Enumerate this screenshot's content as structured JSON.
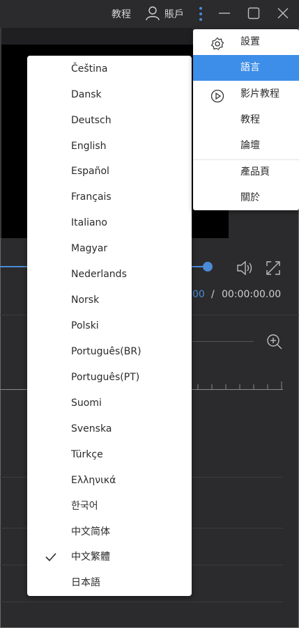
{
  "titlebar": {
    "tutorial_label": "教程",
    "account_label": "賬戶"
  },
  "player": {
    "current_time": "00",
    "time_separator": "/",
    "total_time": "00:00:00.00"
  },
  "language_menu": {
    "items": [
      {
        "label": "Čeština"
      },
      {
        "label": "Dansk"
      },
      {
        "label": "Deutsch"
      },
      {
        "label": "English"
      },
      {
        "label": "Español"
      },
      {
        "label": "Français"
      },
      {
        "label": "Italiano"
      },
      {
        "label": "Magyar"
      },
      {
        "label": "Nederlands"
      },
      {
        "label": "Norsk"
      },
      {
        "label": "Polski"
      },
      {
        "label": "Português(BR)"
      },
      {
        "label": "Português(PT)"
      },
      {
        "label": "Suomi"
      },
      {
        "label": "Svenska"
      },
      {
        "label": "Türkçe"
      },
      {
        "label": "Ελληνικά"
      },
      {
        "label": "한국어"
      },
      {
        "label": "中文简体"
      },
      {
        "label": "中文繁體",
        "selected": true
      },
      {
        "label": "日本語"
      }
    ]
  },
  "settings_menu": {
    "items": [
      {
        "label": "設置",
        "icon": "gear-icon"
      },
      {
        "label": "語言",
        "highlighted": true
      },
      {
        "label": "影片教程",
        "icon": "play-circle-icon"
      },
      {
        "label": "教程"
      },
      {
        "label": "論壇"
      },
      {
        "label": "產品頁"
      },
      {
        "label": "關於"
      }
    ]
  },
  "colors": {
    "accent": "#3d8ee8",
    "background": "#2b2b2d"
  }
}
